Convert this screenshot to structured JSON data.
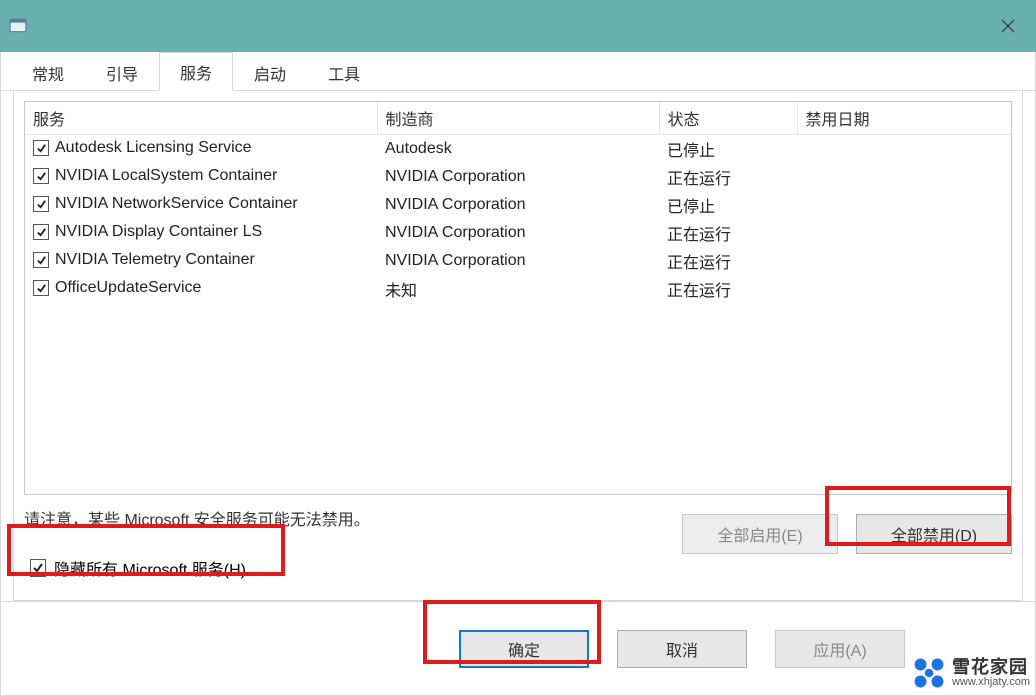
{
  "window": {
    "close_glyph": "✕"
  },
  "tabs": [
    {
      "label": "常规",
      "active": false
    },
    {
      "label": "引导",
      "active": false
    },
    {
      "label": "服务",
      "active": true
    },
    {
      "label": "启动",
      "active": false
    },
    {
      "label": "工具",
      "active": false
    }
  ],
  "columns": {
    "service": "服务",
    "manufacturer": "制造商",
    "status": "状态",
    "disable_date": "禁用日期"
  },
  "services": [
    {
      "name": "Autodesk Licensing Service",
      "manufacturer": "Autodesk",
      "status": "已停止",
      "checked": true
    },
    {
      "name": "NVIDIA LocalSystem Container",
      "manufacturer": "NVIDIA Corporation",
      "status": "正在运行",
      "checked": true
    },
    {
      "name": "NVIDIA NetworkService Container",
      "manufacturer": "NVIDIA Corporation",
      "status": "已停止",
      "checked": true
    },
    {
      "name": "NVIDIA Display Container LS",
      "manufacturer": "NVIDIA Corporation",
      "status": "正在运行",
      "checked": true
    },
    {
      "name": "NVIDIA Telemetry Container",
      "manufacturer": "NVIDIA Corporation",
      "status": "正在运行",
      "checked": true
    },
    {
      "name": "OfficeUpdateService",
      "manufacturer": "未知",
      "status": "正在运行",
      "checked": true
    }
  ],
  "note": "请注意，某些 Microsoft 安全服务可能无法禁用。",
  "buttons": {
    "enable_all": "全部启用(E)",
    "disable_all": "全部禁用(D)",
    "hide_ms": "隐藏所有 Microsoft 服务(H)",
    "ok": "确定",
    "cancel": "取消",
    "apply": "应用(A)"
  },
  "hide_ms_checked": true,
  "watermark": {
    "main": "雪花家园",
    "sub": "www.xhjaty.com"
  }
}
